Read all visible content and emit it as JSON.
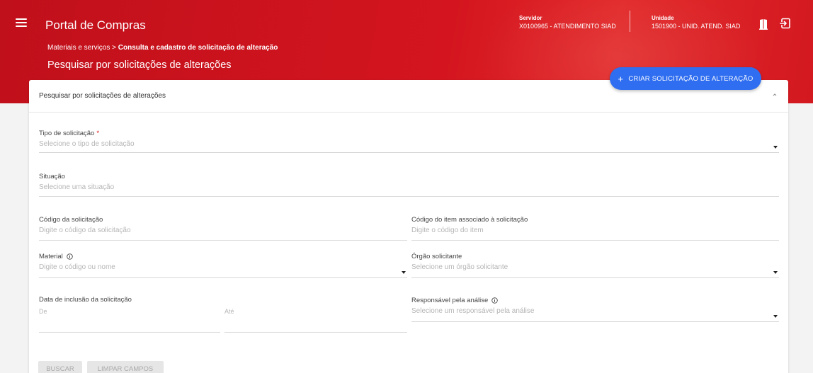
{
  "header": {
    "app_title": "Portal de Compras",
    "servidor_label": "Servidor",
    "servidor_value": "X0100965 - ATENDIMENTO SIAD",
    "unidade_label": "Unidade",
    "unidade_value": "1501900 - UNID. ATEND. SIAD",
    "icons": {
      "menu": "menu-icon",
      "door": "door-icon",
      "exit": "exit-icon"
    }
  },
  "breadcrumb": {
    "parent": "Materiais e serviços",
    "separator": " > ",
    "current": "Consulta e cadastro de solicitação de alteração"
  },
  "page_title": "Pesquisar por solicitações de alterações",
  "create_button": {
    "icon": "+",
    "label": "CRIAR SOLICITAÇÃO DE ALTERAÇÃO"
  },
  "card": {
    "title": "Pesquisar por solicitações de alterações",
    "fields": {
      "tipo": {
        "label": "Tipo de solicitação",
        "required": "*",
        "placeholder": "Selecione o tipo de solicitação"
      },
      "situacao": {
        "label": "Situação",
        "placeholder": "Selecione uma situação"
      },
      "codigo_solicitacao": {
        "label": "Código da solicitação",
        "placeholder": "Digite o código da solicitação"
      },
      "codigo_item": {
        "label": "Código do item associado à solicitação",
        "placeholder": "Digite o código do item"
      },
      "material": {
        "label": "Material",
        "placeholder": "Digite o código ou nome"
      },
      "orgao": {
        "label": "Órgão solicitante",
        "placeholder": "Selecione um órgão solicitante"
      },
      "data_inclusao": {
        "label": "Data de inclusão da solicitação",
        "de": "De",
        "ate": "Até"
      },
      "responsavel": {
        "label": "Responsável pela análise",
        "placeholder": "Selecione um responsável pela análise"
      }
    },
    "buttons": {
      "buscar": "BUSCAR",
      "limpar": "LIMPAR CAMPOS"
    }
  },
  "colors": {
    "header_red": "#d4151f",
    "primary_blue": "#2f6ef0"
  }
}
